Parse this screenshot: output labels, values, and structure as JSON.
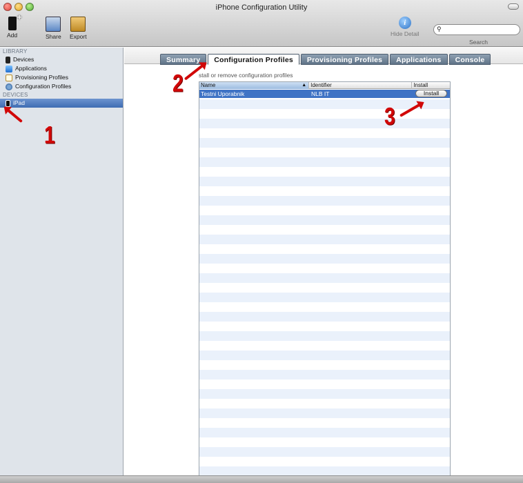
{
  "window": {
    "title": "iPhone Configuration Utility"
  },
  "toolbar": {
    "add_label": "Add",
    "share_label": "Share",
    "export_label": "Export",
    "hide_detail_label": "Hide Detail",
    "info_glyph": "i",
    "search_label": "Search",
    "search_icon_glyph": "⚲"
  },
  "sidebar": {
    "library_header": "LIBRARY",
    "library_items": [
      {
        "label": "Devices",
        "icon": "device-icon"
      },
      {
        "label": "Applications",
        "icon": "app-store-icon"
      },
      {
        "label": "Provisioning Profiles",
        "icon": "document-icon"
      },
      {
        "label": "Configuration Profiles",
        "icon": "gear-icon"
      }
    ],
    "devices_header": "DEVICES",
    "device_items": [
      {
        "label": "iPad",
        "icon": "ipad-icon",
        "selected": true
      }
    ]
  },
  "tabs": [
    {
      "label": "Summary",
      "active": false
    },
    {
      "label": "Configuration Profiles",
      "active": true
    },
    {
      "label": "Provisioning Profiles",
      "active": false
    },
    {
      "label": "Applications",
      "active": false
    },
    {
      "label": "Console",
      "active": false
    }
  ],
  "main": {
    "subtitle": "stall or remove configuration profiles",
    "columns": {
      "name": "Name",
      "identifier": "Identifier",
      "install": "Install",
      "sort_glyph": "▲"
    },
    "rows": [
      {
        "name": "Testni Uporabnik",
        "identifier": "NLB IT",
        "install_button": "Install",
        "selected": true
      }
    ]
  },
  "annotations": {
    "one": "1",
    "two": "2",
    "three": "3"
  },
  "colors": {
    "selection": "#3f73c5",
    "sidebar_bg": "#dfe4ea",
    "annotation": "#d10808"
  }
}
